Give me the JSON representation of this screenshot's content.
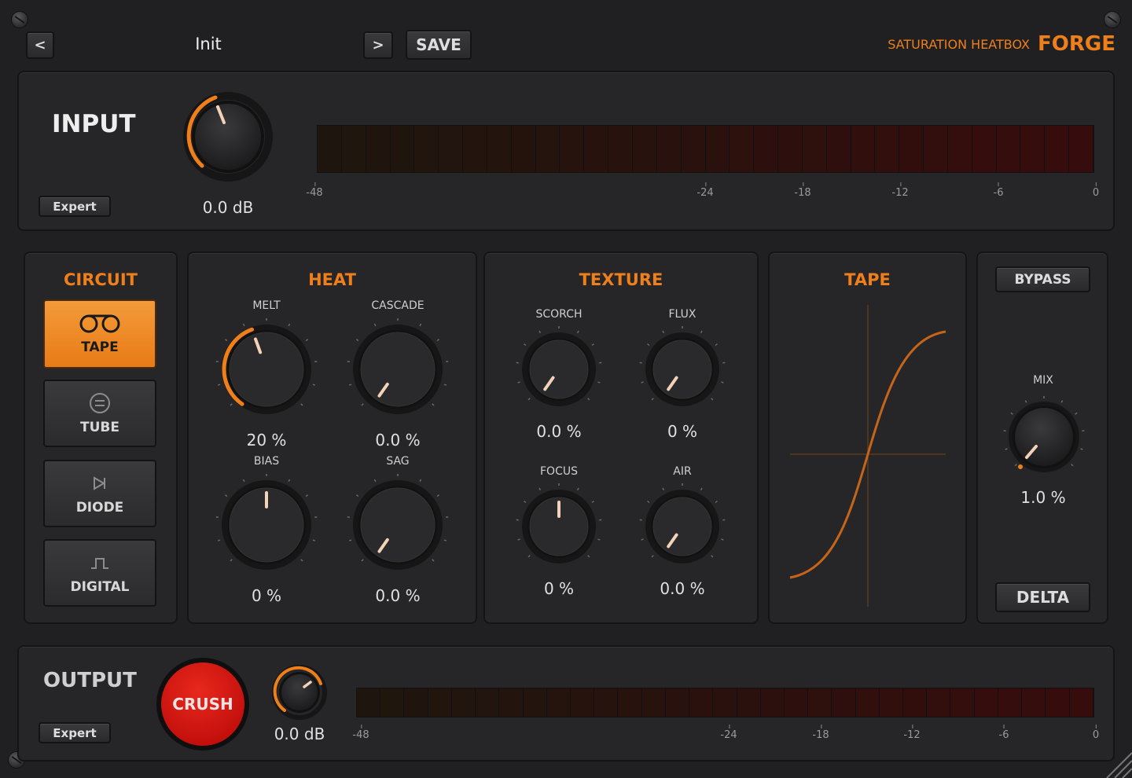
{
  "header": {
    "prev_label": "<",
    "preset_name": "Init",
    "next_label": ">",
    "save_label": "SAVE",
    "brand_sub": "SATURATION HEATBOX",
    "brand_main": "FORGE"
  },
  "input": {
    "title": "INPUT",
    "expert_label": "Expert",
    "gain_value": "0.0 dB",
    "meter_ticks": [
      "-48",
      "-24",
      "-18",
      "-12",
      "-6",
      "0"
    ]
  },
  "circuit": {
    "title": "CIRCUIT",
    "modes": [
      {
        "label": "TAPE",
        "icon": "tape-icon",
        "active": true
      },
      {
        "label": "TUBE",
        "icon": "tube-icon",
        "active": false
      },
      {
        "label": "DIODE",
        "icon": "diode-icon",
        "active": false
      },
      {
        "label": "DIGITAL",
        "icon": "digital-icon",
        "active": false
      }
    ]
  },
  "heat": {
    "title": "HEAT",
    "knobs": [
      {
        "label": "MELT",
        "value": "20 %"
      },
      {
        "label": "CASCADE",
        "value": "0.0 %"
      },
      {
        "label": "BIAS",
        "value": "0 %"
      },
      {
        "label": "SAG",
        "value": "0.0 %"
      }
    ]
  },
  "texture": {
    "title": "TEXTURE",
    "knobs": [
      {
        "label": "SCORCH",
        "value": "0.0 %"
      },
      {
        "label": "FLUX",
        "value": "0 %"
      },
      {
        "label": "FOCUS",
        "value": "0 %"
      },
      {
        "label": "AIR",
        "value": "0.0 %"
      }
    ]
  },
  "tape": {
    "title": "TAPE"
  },
  "right": {
    "bypass_label": "BYPASS",
    "mix_label": "MIX",
    "mix_value": "1.0 %",
    "delta_label": "DELTA"
  },
  "output": {
    "title": "OUTPUT",
    "expert_label": "Expert",
    "crush_label": "CRUSH",
    "gain_value": "0.0 dB",
    "meter_ticks": [
      "-48",
      "-24",
      "-18",
      "-12",
      "-6",
      "0"
    ]
  },
  "colors": {
    "accent": "#ef7f1a",
    "crush": "#d8140f",
    "background": "#202022"
  }
}
